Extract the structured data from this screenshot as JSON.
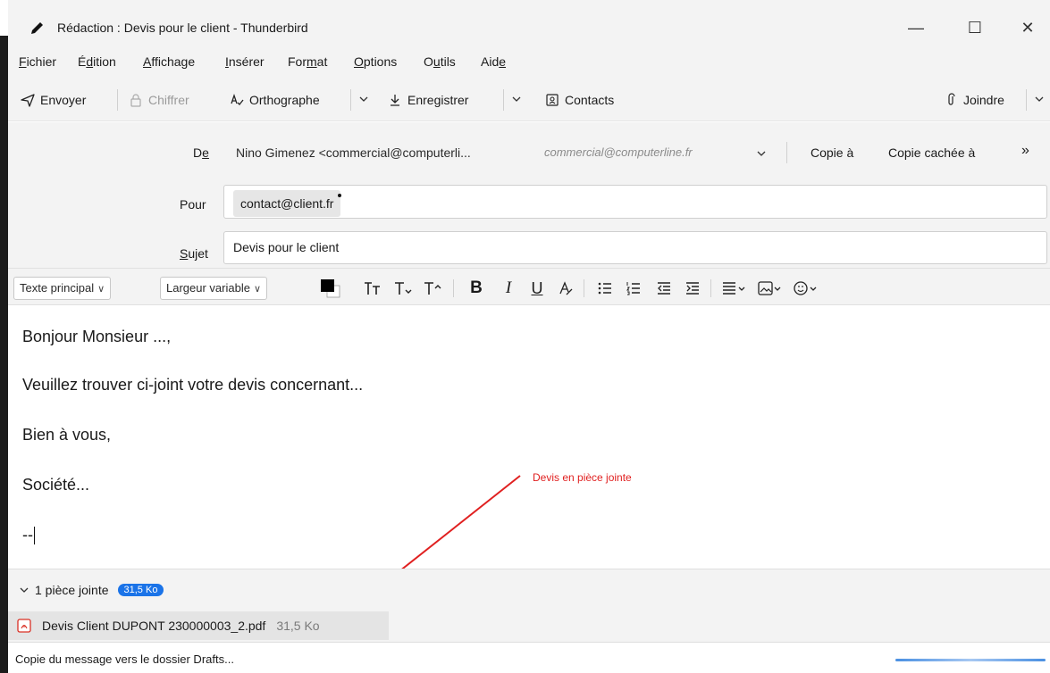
{
  "window": {
    "title": "Rédaction : Devis pour le client - Thunderbird",
    "min_glyph": "—",
    "max_glyph": "☐",
    "close_glyph": "✕"
  },
  "menu": [
    {
      "pre": "",
      "u": "F",
      "post": "ichier"
    },
    {
      "pre": "É",
      "u": "d",
      "post": "ition"
    },
    {
      "pre": "",
      "u": "A",
      "post": "ffichage"
    },
    {
      "pre": "",
      "u": "I",
      "post": "nsérer"
    },
    {
      "pre": "For",
      "u": "m",
      "post": "at"
    },
    {
      "pre": "",
      "u": "O",
      "post": "ptions"
    },
    {
      "pre": "O",
      "u": "u",
      "post": "tils"
    },
    {
      "pre": "Aid",
      "u": "e",
      "post": ""
    }
  ],
  "toolbar": {
    "send": "Envoyer",
    "encrypt": "Chiffrer",
    "spelling": "Orthographe",
    "save": "Enregistrer",
    "contacts": "Contacts",
    "attach": "Joindre"
  },
  "headers": {
    "from_label": "De",
    "from_value": "Nino Gimenez <commercial@computerli...",
    "from_alias": "commercial@computerline.fr",
    "cc": "Copie à",
    "bcc": "Copie cachée à",
    "more": "»",
    "to_label": "Pour",
    "to_pill": "contact@client.fr",
    "subject_label": "Sujet",
    "subject_value": "Devis pour le client"
  },
  "format": {
    "paragraph": "Texte principal",
    "font": "Largeur variable",
    "text_color": "#000000"
  },
  "body": {
    "lines": [
      "Bonjour Monsieur ...,",
      "Veuillez trouver ci-joint votre devis concernant...",
      "Bien à vous,",
      "Société...",
      "--"
    ],
    "annotation": "Devis en pièce jointe"
  },
  "attachments": {
    "summary": "1 pièce jointe",
    "total_size": "31,5 Ko",
    "items": [
      {
        "name": "Devis Client DUPONT 230000003_2.pdf",
        "size": "31,5 Ko"
      }
    ]
  },
  "status": {
    "text": "Copie du message vers le dossier Drafts..."
  },
  "colors": {
    "accent": "#1a73e8",
    "annotation": "#e02020",
    "pdf": "#d93025"
  }
}
